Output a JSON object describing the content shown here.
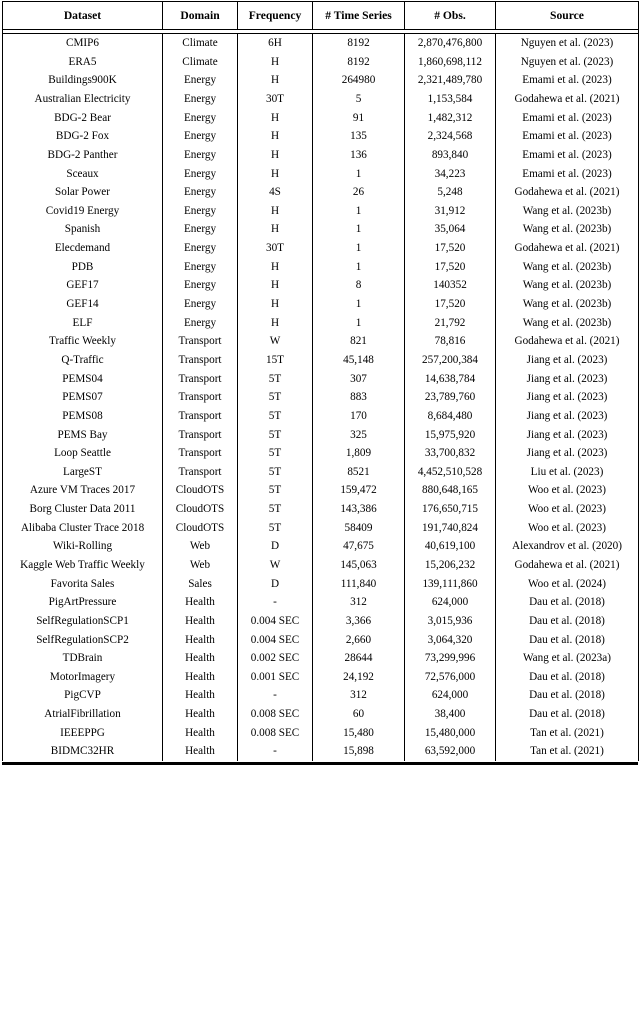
{
  "table": {
    "caption": "",
    "columns": [
      {
        "key": "dataset",
        "label": "Dataset"
      },
      {
        "key": "domain",
        "label": "Domain"
      },
      {
        "key": "frequency",
        "label": "Frequency"
      },
      {
        "key": "series",
        "label": "# Time Series"
      },
      {
        "key": "obs",
        "label": "# Obs."
      },
      {
        "key": "source",
        "label": "Source"
      }
    ],
    "rows": [
      [
        "CMIP6",
        "Climate",
        "6H",
        "8192",
        "2,870,476,800",
        "Nguyen et al. (2023)"
      ],
      [
        "ERA5",
        "Climate",
        "H",
        "8192",
        "1,860,698,112",
        "Nguyen et al. (2023)"
      ],
      [
        "Buildings900K",
        "Energy",
        "H",
        "264980",
        "2,321,489,780",
        "Emami et al. (2023)"
      ],
      [
        "Australian Electricity",
        "Energy",
        "30T",
        "5",
        "1,153,584",
        "Godahewa et al. (2021)"
      ],
      [
        "BDG-2 Bear",
        "Energy",
        "H",
        "91",
        "1,482,312",
        "Emami et al. (2023)"
      ],
      [
        "BDG-2 Fox",
        "Energy",
        "H",
        "135",
        "2,324,568",
        "Emami et al. (2023)"
      ],
      [
        "BDG-2 Panther",
        "Energy",
        "H",
        "136",
        "893,840",
        "Emami et al. (2023)"
      ],
      [
        "Sceaux",
        "Energy",
        "H",
        "1",
        "34,223",
        "Emami et al. (2023)"
      ],
      [
        "Solar Power",
        "Energy",
        "4S",
        "26",
        "5,248",
        "Godahewa et al. (2021)"
      ],
      [
        "Covid19 Energy",
        "Energy",
        "H",
        "1",
        "31,912",
        "Wang et al. (2023b)"
      ],
      [
        "Spanish",
        "Energy",
        "H",
        "1",
        "35,064",
        "Wang et al. (2023b)"
      ],
      [
        "Elecdemand",
        "Energy",
        "30T",
        "1",
        "17,520",
        "Godahewa et al. (2021)"
      ],
      [
        "PDB",
        "Energy",
        "H",
        "1",
        "17,520",
        "Wang et al. (2023b)"
      ],
      [
        "GEF17",
        "Energy",
        "H",
        "8",
        "140352",
        "Wang et al. (2023b)"
      ],
      [
        "GEF14",
        "Energy",
        "H",
        "1",
        "17,520",
        "Wang et al. (2023b)"
      ],
      [
        "ELF",
        "Energy",
        "H",
        "1",
        "21,792",
        "Wang et al. (2023b)"
      ],
      [
        "Traffic Weekly",
        "Transport",
        "W",
        "821",
        "78,816",
        "Godahewa et al. (2021)"
      ],
      [
        "Q-Traffic",
        "Transport",
        "15T",
        "45,148",
        "257,200,384",
        "Jiang et al. (2023)"
      ],
      [
        "PEMS04",
        "Transport",
        "5T",
        "307",
        "14,638,784",
        "Jiang et al. (2023)"
      ],
      [
        "PEMS07",
        "Transport",
        "5T",
        "883",
        "23,789,760",
        "Jiang et al. (2023)"
      ],
      [
        "PEMS08",
        "Transport",
        "5T",
        "170",
        "8,684,480",
        "Jiang et al. (2023)"
      ],
      [
        "PEMS Bay",
        "Transport",
        "5T",
        "325",
        "15,975,920",
        "Jiang et al. (2023)"
      ],
      [
        "Loop Seattle",
        "Transport",
        "5T",
        "1,809",
        "33,700,832",
        "Jiang et al. (2023)"
      ],
      [
        "LargeST",
        "Transport",
        "5T",
        "8521",
        "4,452,510,528",
        "Liu et al. (2023)"
      ],
      [
        "Azure VM Traces 2017",
        "CloudOTS",
        "5T",
        "159,472",
        "880,648,165",
        "Woo et al. (2023)"
      ],
      [
        "Borg Cluster Data 2011",
        "CloudOTS",
        "5T",
        "143,386",
        "176,650,715",
        "Woo et al. (2023)"
      ],
      [
        "Alibaba Cluster Trace 2018",
        "CloudOTS",
        "5T",
        "58409",
        "191,740,824",
        "Woo et al. (2023)"
      ],
      [
        "Wiki-Rolling",
        "Web",
        "D",
        "47,675",
        "40,619,100",
        "Alexandrov et al. (2020)"
      ],
      [
        "Kaggle Web Traffic Weekly",
        "Web",
        "W",
        "145,063",
        "15,206,232",
        "Godahewa et al. (2021)"
      ],
      [
        "Favorita Sales",
        "Sales",
        "D",
        "111,840",
        "139,111,860",
        "Woo et al. (2024)"
      ],
      [
        "PigArtPressure",
        "Health",
        "-",
        "312",
        "624,000",
        "Dau et al. (2018)"
      ],
      [
        "SelfRegulationSCP1",
        "Health",
        "0.004 SEC",
        "3,366",
        "3,015,936",
        "Dau et al. (2018)"
      ],
      [
        "SelfRegulationSCP2",
        "Health",
        "0.004 SEC",
        "2,660",
        "3,064,320",
        "Dau et al. (2018)"
      ],
      [
        "TDBrain",
        "Health",
        "0.002 SEC",
        "28644",
        "73,299,996",
        "Wang et al. (2023a)"
      ],
      [
        "MotorImagery",
        "Health",
        "0.001 SEC",
        "24,192",
        "72,576,000",
        "Dau et al. (2018)"
      ],
      [
        "PigCVP",
        "Health",
        "-",
        "312",
        "624,000",
        "Dau et al. (2018)"
      ],
      [
        "AtrialFibrillation",
        "Health",
        "0.008 SEC",
        "60",
        "38,400",
        "Dau et al. (2018)"
      ],
      [
        "IEEEPPG",
        "Health",
        "0.008 SEC",
        "15,480",
        "15,480,000",
        "Tan et al. (2021)"
      ],
      [
        "BIDMC32HR",
        "Health",
        "-",
        "15,898",
        "63,592,000",
        "Tan et al. (2021)"
      ]
    ]
  },
  "style": {
    "text_color": "#000000",
    "background": "#ffffff",
    "rule_color": "#000000"
  }
}
